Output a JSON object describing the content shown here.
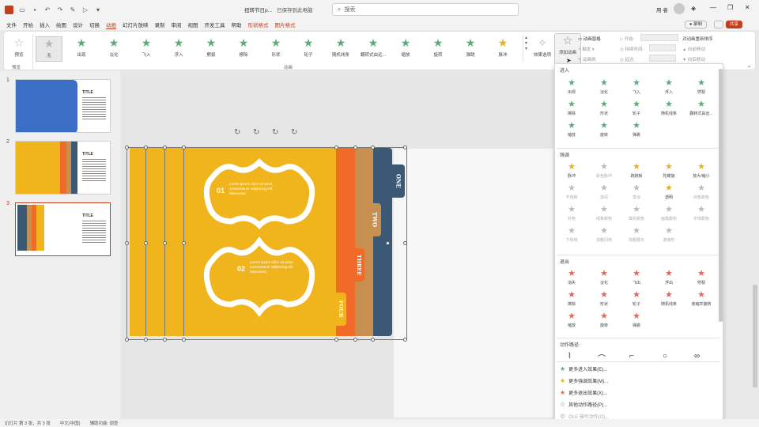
{
  "titlebar": {
    "file_name": "扭转节日p...",
    "save_state": "已保存到此电脑",
    "search_placeholder": "搜索",
    "user_name": "用 者",
    "minimize": "—",
    "restore": "❐",
    "close": "✕"
  },
  "menu": {
    "items": [
      "文件",
      "开始",
      "插入",
      "绘图",
      "设计",
      "切换",
      "动画",
      "幻灯片放映",
      "录制",
      "审阅",
      "视图",
      "开发工具",
      "帮助",
      "形状格式",
      "图片格式"
    ],
    "active": "动画",
    "record_btn": "录制",
    "share_btn": "共享"
  },
  "ribbon": {
    "preview_label": "预览",
    "preview_group": "预览",
    "anim_group": "动画",
    "gallery": [
      "无",
      "出现",
      "淡化",
      "飞入",
      "浮入",
      "劈裂",
      "擦除",
      "形状",
      "轮子",
      "随机线条",
      "翻转式由远...",
      "缩放",
      "旋转",
      "弹跳",
      "脉冲"
    ],
    "effect_options": "效果选项",
    "add_animation": "添加动画",
    "anim_pane": "动画窗格",
    "trigger": "触发",
    "anim_painter": "动画刷",
    "start_label": "开始",
    "duration_label": "持续时间",
    "delay_label": "延迟",
    "reorder_label": "对动画重新排序",
    "move_earlier": "向前移动",
    "move_later": "向后移动"
  },
  "slides": [
    {
      "num": "1",
      "title": "TITLE"
    },
    {
      "num": "2",
      "title": "TITLE"
    },
    {
      "num": "3",
      "title": "TITLE"
    }
  ],
  "slide": {
    "tabs": [
      "ONE",
      "TWO",
      "THREE",
      "FOUR"
    ],
    "num1": "01",
    "num2": "02",
    "body1": "Lorem ipsum dolor sit amet, consectetuer adipiscing elit. Maecenas",
    "body2": "Lorem ipsum dolor sit amet, consectetuer adipiscing elit. Maecenas"
  },
  "pane": {
    "enter_top": "进入",
    "enter_effects": [
      "出现",
      "淡化",
      "飞入",
      "浮入",
      "劈裂",
      "擦除",
      "形状",
      "轮子",
      "随机线条",
      "翻转式由远...",
      "缩放",
      "旋转",
      "弹跳"
    ],
    "emphasis_title": "强调",
    "emphasis_effects": [
      "脉冲",
      "彩色脉冲",
      "跷跷板",
      "陀螺旋",
      "放大/缩小",
      "不饱和",
      "加深",
      "变淡",
      "透明",
      "对象颜色",
      "补色",
      "线条颜色",
      "填充颜色",
      "画笔颜色",
      "字体颜色",
      "下划线",
      "加粗闪烁",
      "加粗展示",
      "波浪形"
    ],
    "emphasis_enabled": [
      true,
      false,
      true,
      true,
      true,
      false,
      false,
      false,
      true,
      false,
      false,
      false,
      false,
      false,
      false,
      false,
      false,
      false,
      false
    ],
    "exit_title": "退出",
    "exit_effects": [
      "消失",
      "淡化",
      "飞出",
      "浮出",
      "劈裂",
      "擦除",
      "形状",
      "轮子",
      "随机线条",
      "收缩并旋转",
      "缩放",
      "旋转",
      "弹跳"
    ],
    "path_title": "动作路径",
    "more": [
      "更多进入效果(E)...",
      "更多强调效果(M)...",
      "更多退出效果(X)...",
      "其他动作路径(P)...",
      "OLE 操作动作(O)..."
    ]
  },
  "status": {
    "slide_info": "幻灯片 第 3 张，共 3 张",
    "language": "中文(中国)",
    "accessibility": "辅助功能: 调查"
  },
  "colors": {
    "accent": "#c43e1c",
    "slide_yellow": "#f0b41c",
    "slide_orange": "#f26a28",
    "slide_brown": "#c89050",
    "slide_navy": "#3b5875",
    "star_green": "#5cab7d",
    "star_gold": "#e6b320",
    "star_red": "#e06a5a"
  }
}
